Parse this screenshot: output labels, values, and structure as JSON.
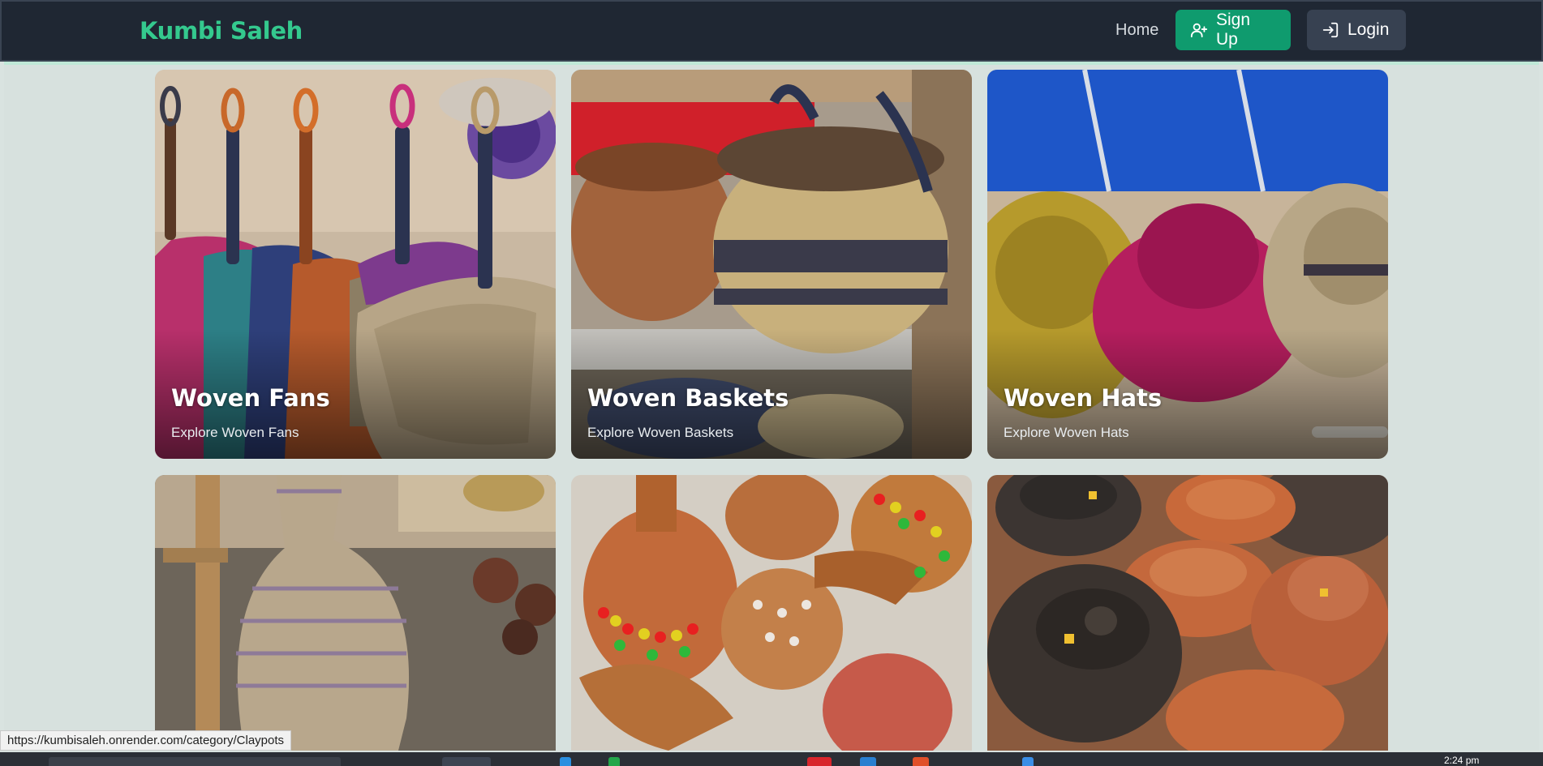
{
  "navbar": {
    "brand": "Kumbi Saleh",
    "home_label": "Home",
    "signup_label": "Sign Up",
    "login_label": "Login"
  },
  "categories": [
    {
      "title": "Woven Fans",
      "subtitle": "Explore Woven Fans"
    },
    {
      "title": "Woven Baskets",
      "subtitle": "Explore Woven Baskets"
    },
    {
      "title": "Woven Hats",
      "subtitle": "Explore Woven Hats"
    },
    {
      "title": "",
      "subtitle": ""
    },
    {
      "title": "",
      "subtitle": ""
    },
    {
      "title": "",
      "subtitle": ""
    }
  ],
  "status_bar": {
    "url": "https://kumbisaleh.onrender.com/category/Claypots"
  },
  "taskbar": {
    "clock": "2:24 pm"
  },
  "colors": {
    "brand": "#34c98e",
    "navbar_bg": "#1f2733",
    "signup_bg": "#0f9b6e",
    "login_bg": "#374151",
    "page_bg": "#d7e1de"
  }
}
